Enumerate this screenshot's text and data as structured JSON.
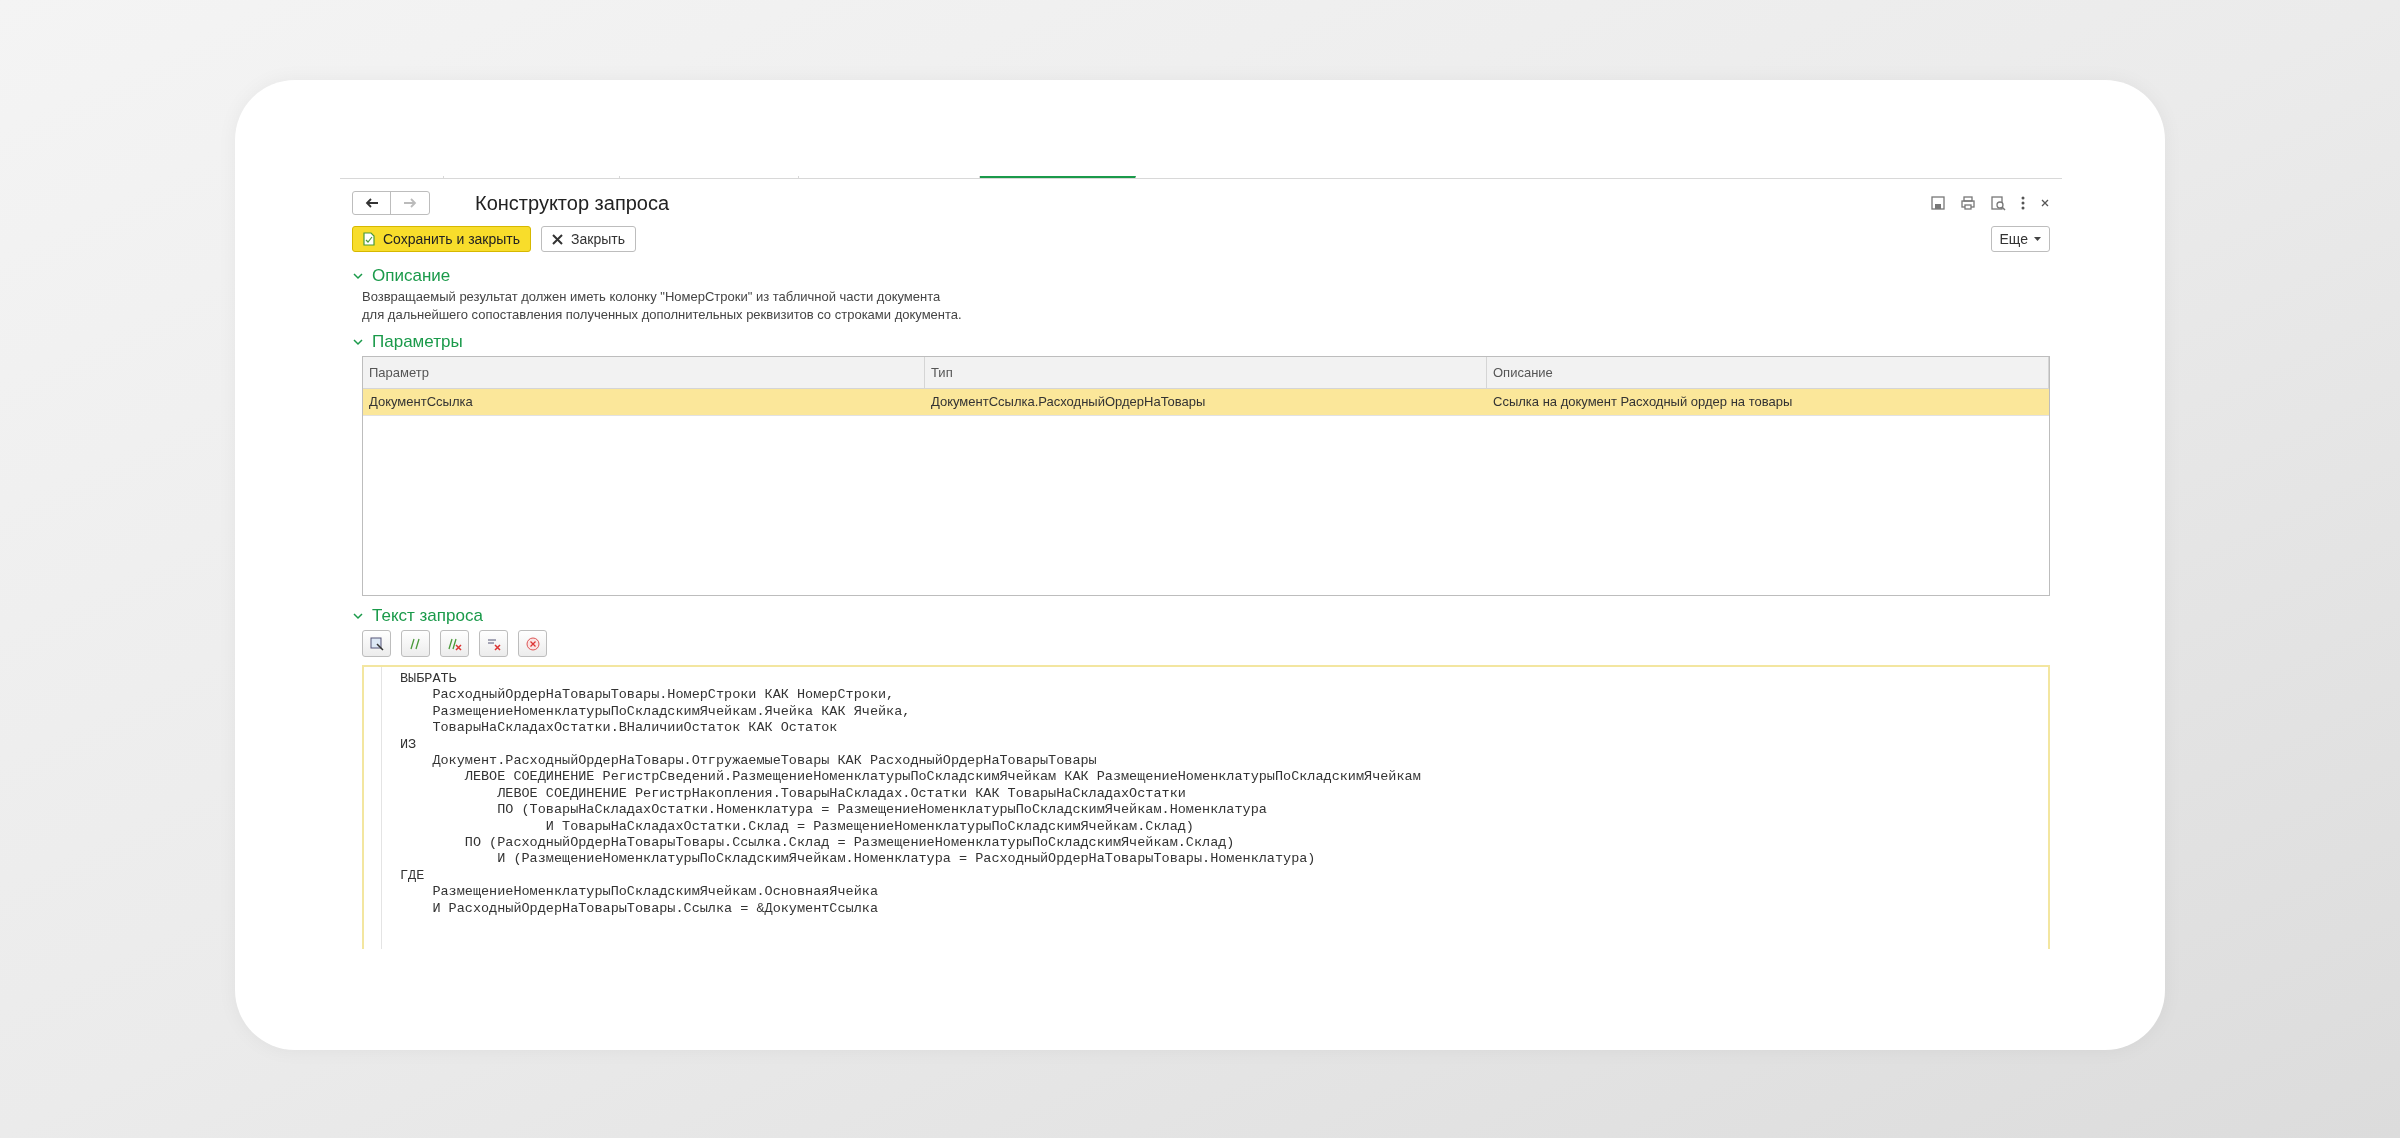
{
  "tabs": [
    {
      "selected": false
    },
    {
      "selected": false
    },
    {
      "selected": false
    },
    {
      "selected": false
    },
    {
      "selected": true
    }
  ],
  "window": {
    "title": "Конструктор запроса"
  },
  "nav": {
    "back_disabled": false,
    "forward_disabled": true
  },
  "buttons": [
    {
      "label": "Сохранить и закрыть",
      "kind": "primary"
    },
    {
      "label": "Закрыть",
      "kind": "close"
    }
  ],
  "more_button": "Еще",
  "description": {
    "title": "Описание",
    "expanded": true,
    "lines": [
      "Возвращаемый результат должен иметь колонку \"НомерСтроки\" из табличной части документа",
      "для дальнейшего сопоставления полученных дополнительных реквизитов со строками документа."
    ]
  },
  "parameters": {
    "title": "Параметры",
    "expanded": true,
    "columns": [
      "Параметр",
      "Тип",
      "Описание"
    ],
    "rows": [
      {
        "cells": [
          "ДокументСсылка",
          "ДокументСсылка.РасходныйОрдерНаТовары",
          "Ссылка на документ Расходный ордер на товары"
        ],
        "selected": true
      }
    ]
  },
  "query": {
    "title": "Текст запроса",
    "expanded": true,
    "lines": [
      "ВЫБРАТЬ",
      "    РасходныйОрдерНаТоварыТовары.НомерСтроки КАК НомерСтроки,",
      "    РазмещениеНоменклатурыПоСкладскимЯчейкам.Ячейка КАК Ячейка,",
      "    ТоварыНаСкладахОстатки.ВНаличииОстаток КАК Остаток",
      "ИЗ",
      "    Документ.РасходныйОрдерНаТовары.ОтгружаемыеТовары КАК РасходныйОрдерНаТоварыТовары",
      "        ЛЕВОЕ СОЕДИНЕНИЕ РегистрСведений.РазмещениеНоменклатурыПоСкладскимЯчейкам КАК РазмещениеНоменклатурыПоСкладскимЯчейкам",
      "            ЛЕВОЕ СОЕДИНЕНИЕ РегистрНакопления.ТоварыНаСкладах.Остатки КАК ТоварыНаСкладахОстатки",
      "            ПО (ТоварыНаСкладахОстатки.Номенклатура = РазмещениеНоменклатурыПоСкладскимЯчейкам.Номенклатура",
      "                  И ТоварыНаСкладахОстатки.Склад = РазмещениеНоменклатурыПоСкладскимЯчейкам.Склад)",
      "        ПО (РасходныйОрдерНаТоварыТовары.Ссылка.Склад = РазмещениеНоменклатурыПоСкладскимЯчейкам.Склад)",
      "            И (РазмещениеНоменклатурыПоСкладскимЯчейкам.Номенклатура = РасходныйОрдерНаТоварыТовары.Номенклатура)",
      "ГДЕ",
      "    РазмещениеНоменклатурыПоСкладскимЯчейкам.ОсновнаяЯчейка",
      "    И РасходныйОрдерНаТоварыТовары.Ссылка = &ДокументСсылка"
    ]
  }
}
